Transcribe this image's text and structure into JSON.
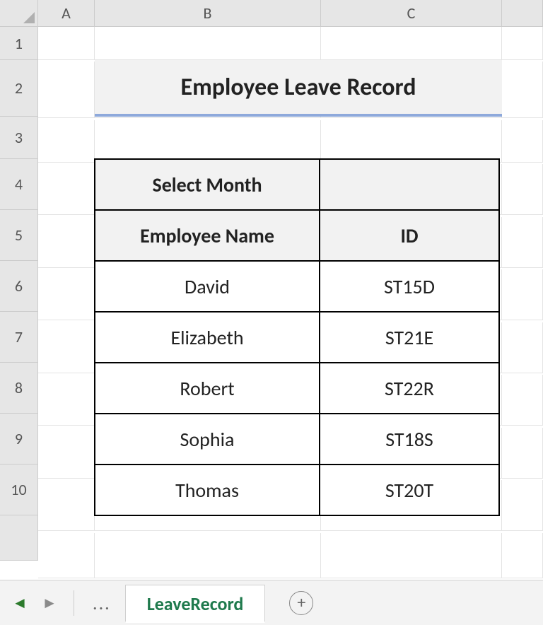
{
  "columns": [
    "A",
    "B",
    "C"
  ],
  "rows": [
    "1",
    "2",
    "3",
    "4",
    "5",
    "6",
    "7",
    "8",
    "9",
    "10"
  ],
  "title": "Employee Leave Record",
  "table": {
    "select_month_label": "Select Month",
    "select_month_value": "",
    "headers": {
      "name": "Employee Name",
      "id": "ID"
    },
    "data": [
      {
        "name": "David",
        "id": "ST15D"
      },
      {
        "name": "Elizabeth",
        "id": "ST21E"
      },
      {
        "name": "Robert",
        "id": "ST22R"
      },
      {
        "name": "Sophia",
        "id": "ST18S"
      },
      {
        "name": "Thomas",
        "id": "ST20T"
      }
    ]
  },
  "tabs": {
    "active": "LeaveRecord",
    "overflow": "..."
  },
  "nav": {
    "prev_glyph": "◄",
    "next_glyph": "►",
    "add_glyph": "+"
  }
}
